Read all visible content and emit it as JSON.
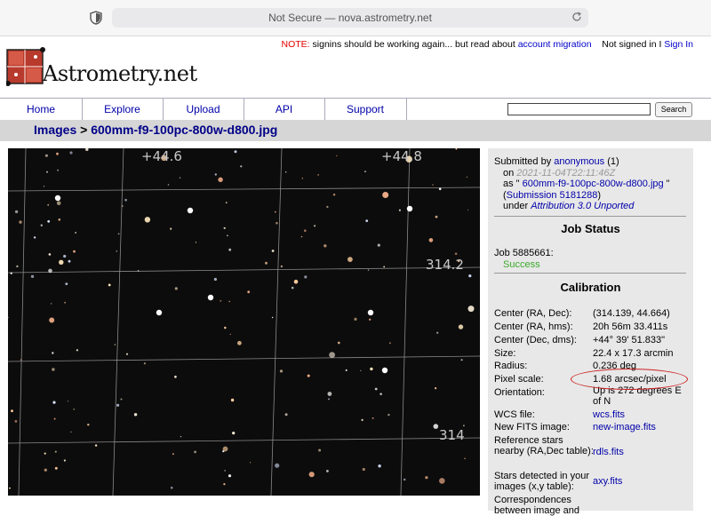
{
  "browser": {
    "url": "Not Secure — nova.astrometry.net"
  },
  "header": {
    "note_label": "NOTE:",
    "note_text": " signins should be working again... but read about ",
    "note_link": "account migration",
    "signed_status": "Not signed in I ",
    "signin_link": "Sign In",
    "logo_text": "Astrometry.net"
  },
  "nav": {
    "items": [
      "Home",
      "Explore",
      "Upload",
      "API",
      "Support"
    ],
    "search_button": "Search"
  },
  "breadcrumb": {
    "root": "Images",
    "sep": " > ",
    "current": "600mm-f9-100pc-800w-d800.jpg"
  },
  "image": {
    "grid_labels": [
      "+44.6",
      "+44.8",
      "314.2",
      "314"
    ]
  },
  "info": {
    "submitted_by_label": "Submitted by ",
    "submitted_by": "anonymous",
    "submitted_count": " (1)",
    "on_label": "on ",
    "on_date": "2021-11-04T22:11:46Z",
    "as_label": "as \" ",
    "as_name": "600mm-f9-100pc-800w-d800.jpg",
    "as_close": " \"",
    "submission_open": "(",
    "submission_link": "Submission 5181288",
    "submission_close": ")",
    "under_label": "under ",
    "license": "Attribution 3.0 Unported",
    "job_status_heading": "Job Status",
    "job_label": "Job 5885661:",
    "job_status": "Success",
    "calibration_heading": "Calibration",
    "calibration": [
      {
        "label": "Center (RA, Dec):",
        "value": "(314.139, 44.664)"
      },
      {
        "label": "Center (RA, hms):",
        "value": "20h 56m 33.411s"
      },
      {
        "label": "Center (Dec, dms):",
        "value": "+44° 39' 51.833\""
      },
      {
        "label": "Size:",
        "value": "22.4 x 17.3 arcmin"
      },
      {
        "label": "Radius:",
        "value": "0.236 deg"
      },
      {
        "label": "Pixel scale:",
        "value": "1.68 arcsec/pixel"
      },
      {
        "label": "Orientation:",
        "value": "Up is 272 degrees E of N"
      },
      {
        "label": "WCS file:",
        "value": "wcs.fits"
      },
      {
        "label": "New FITS image:",
        "value": "new-image.fits"
      },
      {
        "label": "Reference stars nearby (RA,Dec table):",
        "value": "rdls.fits"
      },
      {
        "label": "Stars detected in your images (x,y table):",
        "value": "axy.fits"
      },
      {
        "label": "Correspondences between image and",
        "value": ""
      }
    ]
  },
  "colors": {
    "link": "#0000aa",
    "success": "#3aaa2a",
    "note": "#e00000",
    "annotation": "#cc2222"
  }
}
